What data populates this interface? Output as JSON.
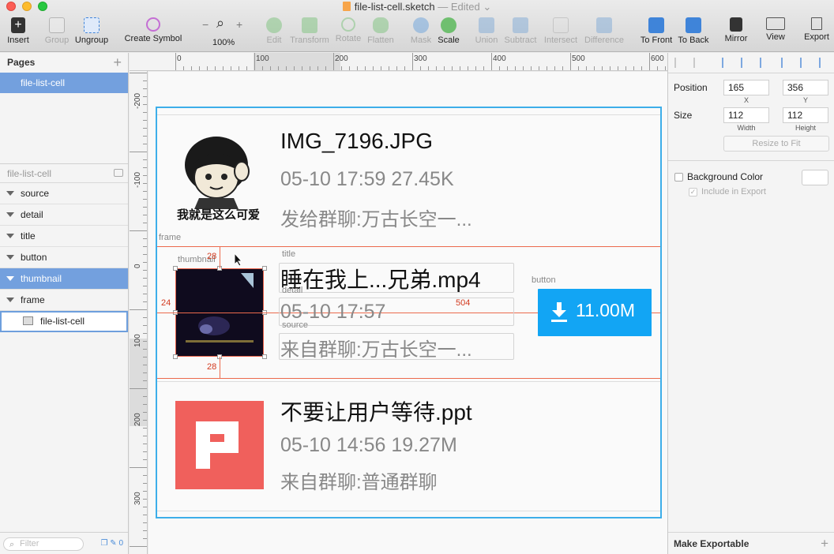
{
  "window": {
    "title": "file-list-cell.sketch",
    "status": "— Edited"
  },
  "toolbar": {
    "insert": "Insert",
    "group": "Group",
    "ungroup": "Ungroup",
    "create_symbol": "Create Symbol",
    "zoom_minus": "−",
    "zoom_plus": "+",
    "zoom_level": "100%",
    "edit": "Edit",
    "transform": "Transform",
    "rotate": "Rotate",
    "flatten": "Flatten",
    "mask": "Mask",
    "scale": "Scale",
    "union": "Union",
    "subtract": "Subtract",
    "intersect": "Intersect",
    "difference": "Difference",
    "to_front": "To Front",
    "to_back": "To Back",
    "mirror": "Mirror",
    "view": "View",
    "export": "Export"
  },
  "pages": {
    "header": "Pages",
    "add": "+",
    "items": [
      "file-list-cell"
    ]
  },
  "layers": {
    "header": "file-list-cell",
    "items": [
      "source",
      "detail",
      "title",
      "button",
      "thumbnail",
      "frame"
    ],
    "artboard": "file-list-cell"
  },
  "filter": {
    "placeholder": "Filter",
    "count": "0"
  },
  "ruler_top": [
    "0",
    "100",
    "200",
    "300",
    "400",
    "500",
    "600"
  ],
  "ruler_left": [
    "-200",
    "-100",
    "0",
    "100",
    "200",
    "300"
  ],
  "cells": [
    {
      "title": "IMG_7196.JPG",
      "detail": "05-10 17:59 27.45K",
      "source": "发给群聊:万古长空一...",
      "meme_caption": "我就是这么可爱"
    },
    {
      "title": "睡在我上...兄弟.mp4",
      "detail": "05-10 17:57",
      "source": "来自群聊:万古长空一...",
      "button": "11.00M"
    },
    {
      "title": "不要让用户等待.ppt",
      "detail": "05-10 14:56 19.27M",
      "source": "来自群聊:普通群聊",
      "icon_letter": "P"
    }
  ],
  "layer_labels": {
    "frame": "frame",
    "thumbnail": "thumbnail",
    "title": "title",
    "detail": "detail",
    "source": "source",
    "button": "button"
  },
  "measures": {
    "top": "28",
    "bottom": "28",
    "left": "24",
    "right": "504"
  },
  "inspector": {
    "position_label": "Position",
    "x": "165",
    "y": "356",
    "x_sub": "X",
    "y_sub": "Y",
    "size_label": "Size",
    "width": "112",
    "height": "112",
    "width_sub": "Width",
    "height_sub": "Height",
    "resize": "Resize to Fit",
    "bg_color": "Background Color",
    "include_export": "Include in Export",
    "make_exportable": "Make Exportable",
    "add": "+"
  },
  "colors": {
    "accent": "#3daee9",
    "button": "#12a5f4",
    "ppt": "#f0605c",
    "guide": "#ec6a4d",
    "selection": "#73a0de"
  }
}
